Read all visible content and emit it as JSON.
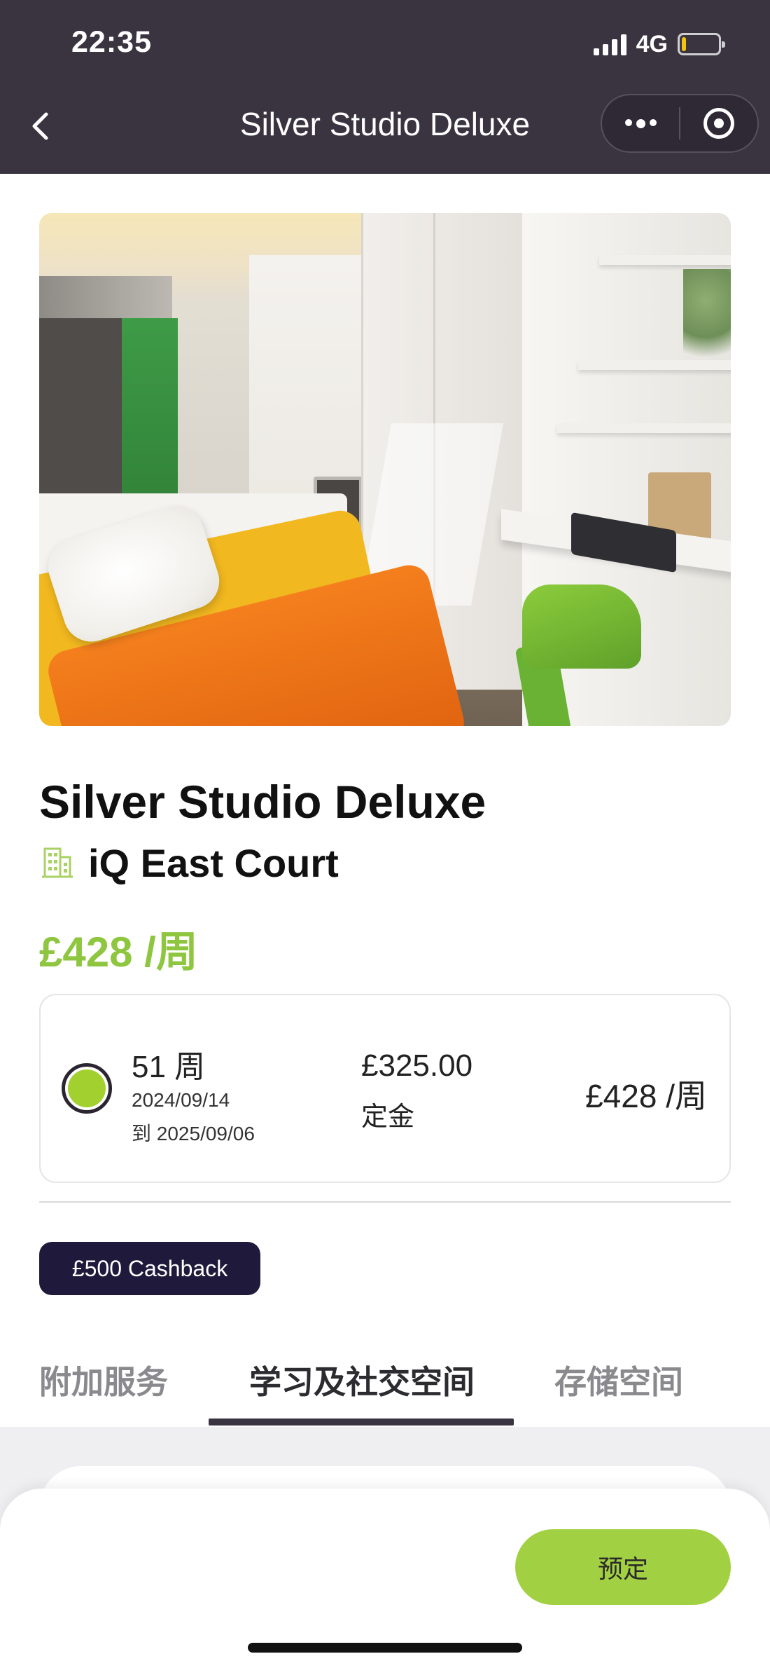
{
  "status_bar": {
    "time": "22:35",
    "network": "4G",
    "signal_bars": 4,
    "battery_level": 0.12
  },
  "nav": {
    "title": "Silver Studio Deluxe",
    "back_icon": "chevron-left-icon",
    "more_icon": "more-dots-icon",
    "close_icon": "target-circle-icon"
  },
  "listing": {
    "room_name": "Silver Studio Deluxe",
    "building_icon": "building-icon",
    "building_name": "iQ East Court",
    "price": "£428 /周"
  },
  "tenancy_option": {
    "selected": true,
    "weeks": "51 周",
    "start_date": "2024/09/14",
    "end_date": "到 2025/09/06",
    "deposit_amount": "£325.00",
    "deposit_label": "定金",
    "price": "£428 /周"
  },
  "promo": {
    "cashback_label": "£500 Cashback"
  },
  "tabs": [
    {
      "label": "附加服务",
      "active": false
    },
    {
      "label": "学习及社交空间",
      "active": true
    },
    {
      "label": "存储空间",
      "active": false
    }
  ],
  "actions": {
    "book_label": "预定"
  },
  "colors": {
    "header_bg": "#3a3441",
    "accent_green": "#8ec63f",
    "button_green": "#a2d043",
    "cashback_bg": "#1f1a3b"
  }
}
